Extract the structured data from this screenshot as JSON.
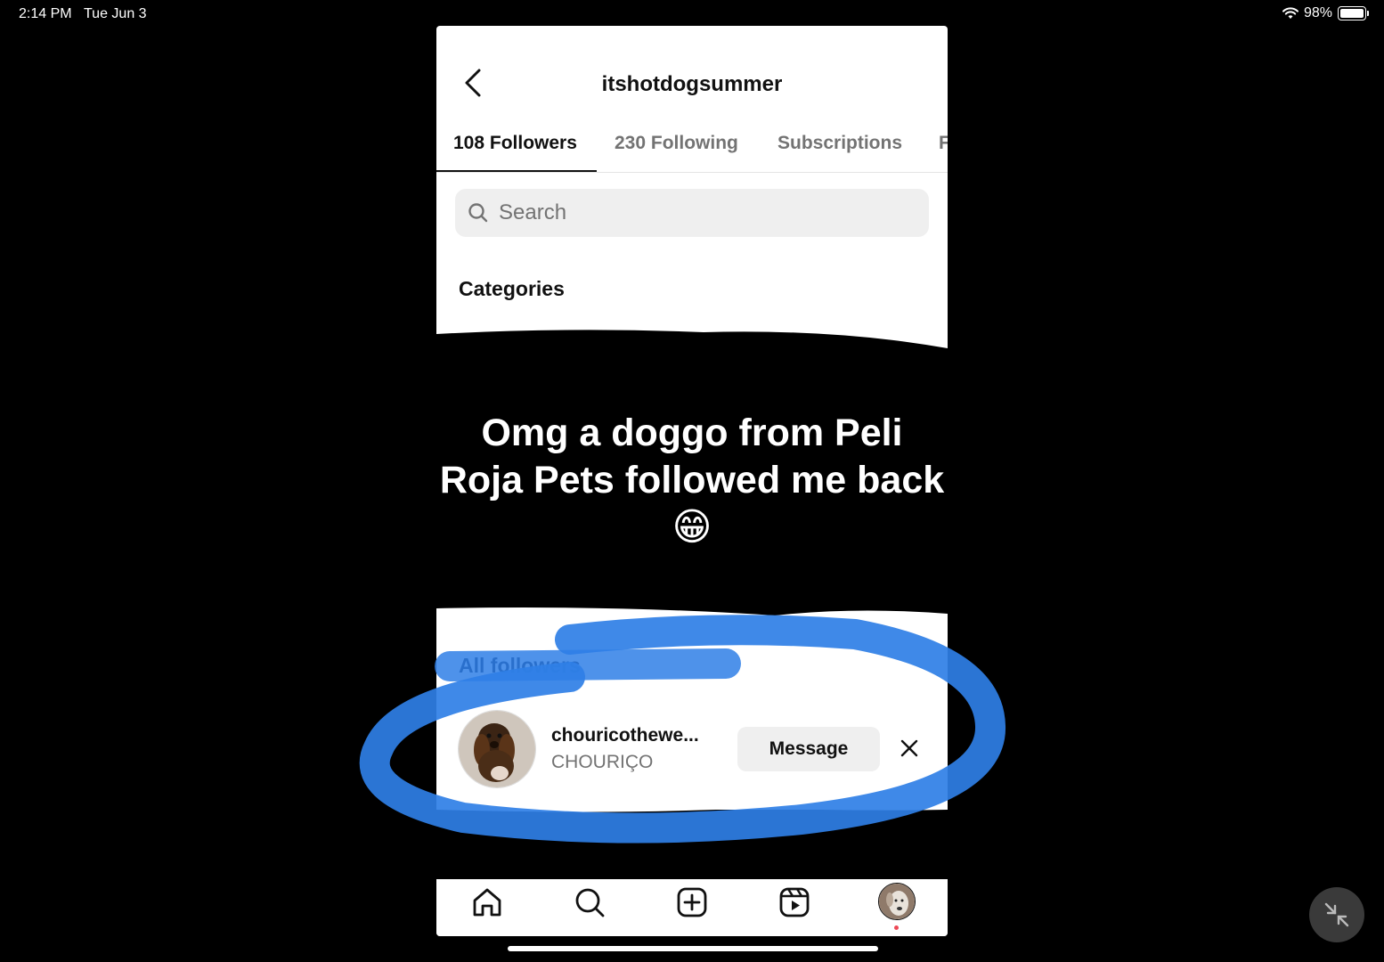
{
  "status_bar": {
    "time": "2:14 PM",
    "date": "Tue Jun 3",
    "battery": "98%",
    "battery_level": 0.98
  },
  "header": {
    "title": "itshotdogsummer"
  },
  "tabs": [
    {
      "label": "108 Followers",
      "active": true
    },
    {
      "label": "230 Following",
      "active": false
    },
    {
      "label": "Subscriptions",
      "active": false
    },
    {
      "label": "F",
      "active": false
    }
  ],
  "search": {
    "placeholder": "Search"
  },
  "sections": {
    "categories": "Categories",
    "all_followers": "All followers"
  },
  "overlay": {
    "line1": "Omg a doggo from Peli",
    "line2": "Roja Pets followed me back",
    "emoji": "😁"
  },
  "follower": {
    "username": "chouricothewe...",
    "full_name": "CHOURIÇO",
    "message_label": "Message"
  },
  "colors": {
    "annotation_blue": "#2f7fe6",
    "inactive_text": "#737373",
    "notification": "#ed4956"
  },
  "icons": [
    "back-chevron-icon",
    "search-icon",
    "close-icon",
    "home-icon",
    "explore-icon",
    "create-icon",
    "reels-icon",
    "profile-avatar",
    "shrink-arrows-icon",
    "wifi-icon",
    "battery-icon"
  ]
}
